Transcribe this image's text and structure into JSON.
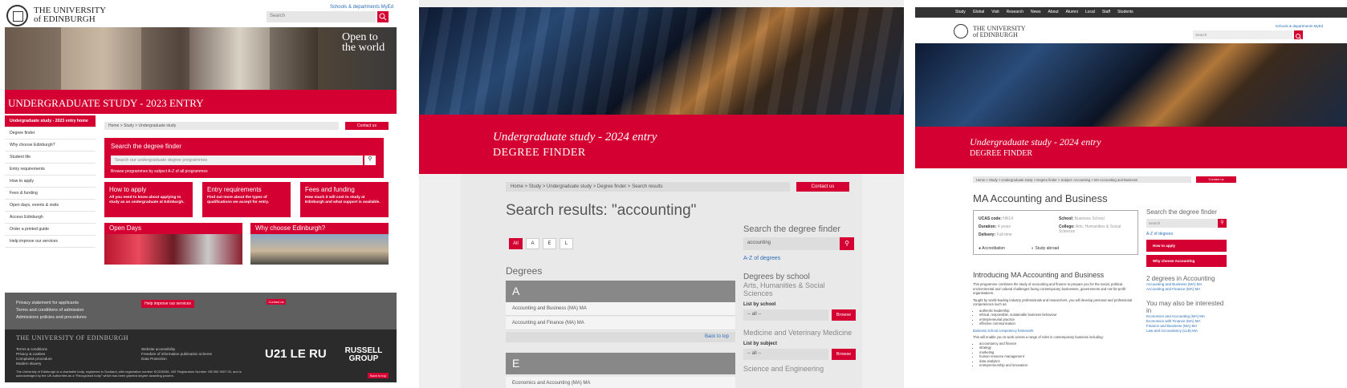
{
  "p1": {
    "brand": "THE UNIVERSITY of EDINBURGH",
    "toplinks": "Schools & departments   MyEd",
    "search_placeholder": "Search",
    "hero_text": "Open to the world",
    "band": "UNDERGRADUATE STUDY - 2023 ENTRY",
    "side": [
      "Undergraduate study - 2023 entry home",
      "Degree finder",
      "Why choose Edinburgh?",
      "Student life",
      "Entry requirements",
      "How to apply",
      "Fees & funding",
      "Open days, events & visits",
      "Access Edinburgh",
      "Order a printed guide",
      "Help improve our services"
    ],
    "crumb": "Home  >  Study  >  Undergraduate study",
    "contact": "Contact us",
    "finder_title": "Search the degree finder",
    "finder_placeholder": "Search our undergraduate degree programmes",
    "finder_links": "Browse programmes by subject    A-Z of all programmes",
    "cards": [
      {
        "h": "How to apply",
        "b": "All you need to know about applying to study as an undergraduate at Edinburgh."
      },
      {
        "h": "Entry requirements",
        "b": "Find out more about the types of qualifications we accept for entry."
      },
      {
        "h": "Fees and funding",
        "b": "How much it will cost to study at Edinburgh and what support is available."
      }
    ],
    "pics": [
      "Open Days",
      "Why choose Edinburgh?"
    ],
    "footer_links": [
      "Privacy statement for applicants",
      "Terms and conditions of admission",
      "Admissions policies and procedures"
    ],
    "help_button": "Help improve our services",
    "contact_small": "Contact us",
    "uni_name": "THE UNIVERSITY OF EDINBURGH",
    "legal_left": [
      "Terms & conditions",
      "Privacy & cookies",
      "Complaints procedure",
      "Modern slavery"
    ],
    "legal_right": [
      "Website accessibility",
      "Freedom of information publication scheme",
      "Data Protection"
    ],
    "u21": "U21 LE RU",
    "russell": "RUSSELL GROUP",
    "charity": "The University of Edinburgh is a charitable body, registered in Scotland, with registration number SC005336, VAT Registration Number GB 592 9507 00, and is acknowledged by the UK authorities as a \"Recognised body\" which has been granted degree awarding powers.",
    "back_top": "Back to top"
  },
  "p2": {
    "band_a": "Undergraduate study - 2024 entry",
    "band_b": "DEGREE FINDER",
    "crumb": "Home  >  Study  >  Undergraduate study  >  Degree finder  >  Search results",
    "contact": "Contact us",
    "title": "Search results: \"accounting\"",
    "letters": [
      "All",
      "A",
      "E",
      "L"
    ],
    "degrees": "Degrees",
    "head_a": "A",
    "rows_a": [
      "Accounting and Business (MA) MA",
      "Accounting and Finance (MA) MA"
    ],
    "back": "Back to top",
    "head_e": "E",
    "row_e": "Economics and Accounting (MA) MA",
    "rs_title": "Search the degree finder",
    "rs_value": "accounting",
    "az": "A-Z of degrees",
    "by_school": "Degrees by school",
    "school1": "Arts, Humanities & Social Sciences",
    "list_school": "List by school",
    "all": "-- all --",
    "browse": "Browse",
    "school2": "Medicine and Veterinary Medicine",
    "list_subject": "List by subject",
    "school3": "Science and Engineering"
  },
  "p3": {
    "nav": [
      "Study",
      "Global",
      "Visit",
      "Research",
      "News",
      "About",
      "Alumni",
      "Local",
      "Staff",
      "Students"
    ],
    "brand": "THE UNIVERSITY of EDINBURGH",
    "toplinks": "Schools & departments   MyEd",
    "search": "Search",
    "band_a": "Undergraduate study - 2024 entry",
    "band_b": "DEGREE FINDER",
    "crumb": "Home  >  Study  >  Undergraduate study  >  Degree finder  >  Subject: Accounting  >  MA Accounting and Business",
    "contact": "Contact us",
    "title": "MA Accounting and Business",
    "ucas_k": "UCAS code:",
    "ucas_v": "NN14",
    "dur_k": "Duration:",
    "dur_v": "4 years",
    "del_k": "Delivery:",
    "del_v": "Full-time",
    "sch_k": "School:",
    "sch_v": "Business School",
    "col_k": "College:",
    "col_v": "Arts, Humanities & Social Sciences",
    "accr": "Accreditation",
    "abroad": "Study abroad",
    "intro": "Introducing MA Accounting and Business",
    "p1": "This programme combines the study of accounting and finance to prepare you for the social, political, environmental and cultural challenges facing contemporary businesses, governments and not-for-profit organisations.",
    "p2": "Taught by world-leading industry professionals and researchers, you will develop personal and professional competencies such as:",
    "list1": [
      "authentic leadership",
      "ethical, responsible, sustainable business behaviour",
      "entrepreneurial practice",
      "effective communication"
    ],
    "link": "Business School competency framework",
    "p3": "This will enable you to work across a range of roles in contemporary business including:",
    "list2": [
      "accountancy and finance",
      "strategy",
      "marketing",
      "human resource management",
      "data analytics",
      "entrepreneurship and innovation"
    ],
    "rs_title": "Search the degree finder",
    "rs_search": "Search",
    "az": "A-Z of degrees",
    "apply": "How to apply",
    "why": "Why choose Accounting",
    "deg_head": "2 degrees in Accounting",
    "deg_links": [
      "Accounting and Business (MA) MA",
      "Accounting and Finance (MA) MA"
    ],
    "also": "You may also be interested in",
    "also_links": [
      "Economics and Accounting (MA) MA",
      "Economics with Finance (MA) MA",
      "Finance and Business (MA) MA",
      "Law and Accountancy (LLB) MA"
    ]
  }
}
